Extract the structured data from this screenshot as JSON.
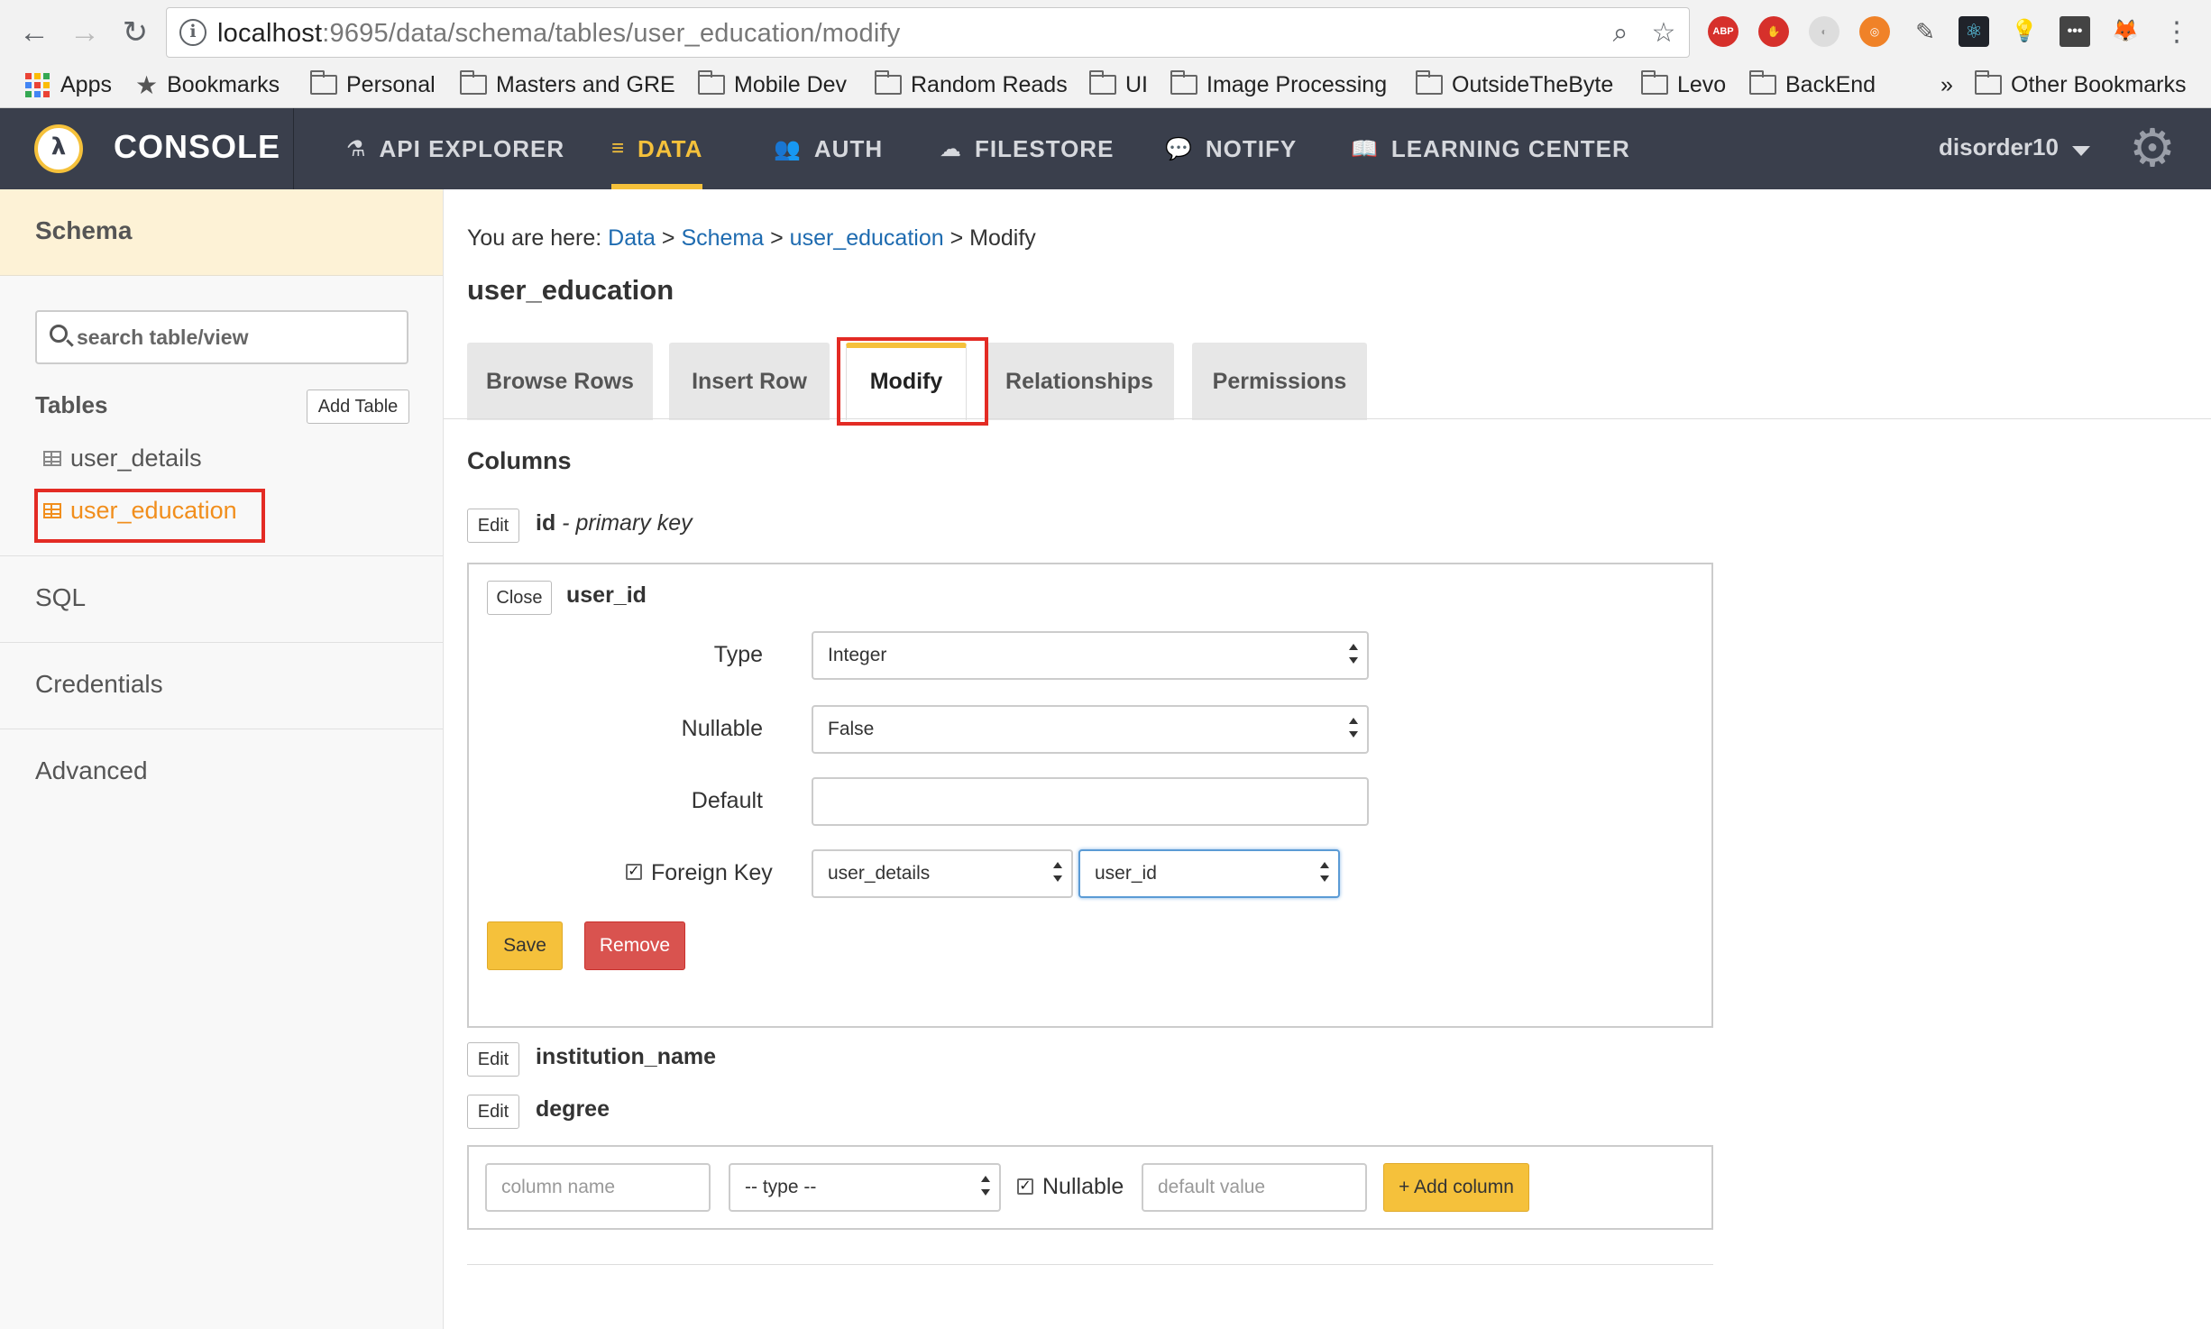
{
  "browser": {
    "url_host": "localhost",
    "url_rest": ":9695/data/schema/tables/user_education/modify",
    "bookmarks": [
      "Apps",
      "Bookmarks",
      "Personal",
      "Masters and GRE",
      "Mobile Dev",
      "Random Reads",
      "UI",
      "Image Processing",
      "OutsideTheByte",
      "Levo",
      "BackEnd"
    ],
    "overflow": "»",
    "other_bookmarks": "Other Bookmarks",
    "extensions": [
      "ABP"
    ]
  },
  "header": {
    "brand": "CONSOLE",
    "tabs": [
      {
        "label": "API EXPLORER",
        "icon": "flask-icon"
      },
      {
        "label": "DATA",
        "icon": "database-icon",
        "active": true
      },
      {
        "label": "AUTH",
        "icon": "users-icon"
      },
      {
        "label": "FILESTORE",
        "icon": "cloud-upload-icon"
      },
      {
        "label": "NOTIFY",
        "icon": "comment-icon"
      },
      {
        "label": "LEARNING CENTER",
        "icon": "book-icon"
      }
    ],
    "user": "disorder10",
    "accent": "#f5c13b",
    "background": "#3a3f4c"
  },
  "sidebar": {
    "schema": "Schema",
    "search_placeholder": "search table/view",
    "tables_label": "Tables",
    "add_table": "Add Table",
    "tables": [
      "user_details",
      "user_education"
    ],
    "active_table": "user_education",
    "sections": [
      "SQL",
      "Credentials",
      "Advanced"
    ]
  },
  "main": {
    "breadcrumb": {
      "prefix": "You are here: ",
      "items": [
        "Data",
        "Schema",
        "user_education",
        "Modify"
      ],
      "sep": " > "
    },
    "title": "user_education",
    "tabs": [
      "Browse Rows",
      "Insert Row",
      "Modify",
      "Relationships",
      "Permissions"
    ],
    "active_tab": "Modify",
    "columns_title": "Columns",
    "edit_label": "Edit",
    "close_label": "Close",
    "columns": [
      {
        "name": "id",
        "note": "- primary key"
      },
      {
        "name": "user_id"
      },
      {
        "name": "institution_name"
      },
      {
        "name": "degree"
      }
    ],
    "editor": {
      "type_label": "Type",
      "type_value": "Integer",
      "nullable_label": "Nullable",
      "nullable_value": "False",
      "default_label": "Default",
      "default_value": "",
      "fk_label": "Foreign Key",
      "fk_checked": true,
      "fk_table": "user_details",
      "fk_column": "user_id",
      "save": "Save",
      "remove": "Remove"
    },
    "new_column": {
      "name_placeholder": "column name",
      "type_value": "-- type --",
      "nullable_label": "Nullable",
      "nullable_checked": true,
      "default_placeholder": "default value",
      "add_label": "+ Add column"
    }
  }
}
